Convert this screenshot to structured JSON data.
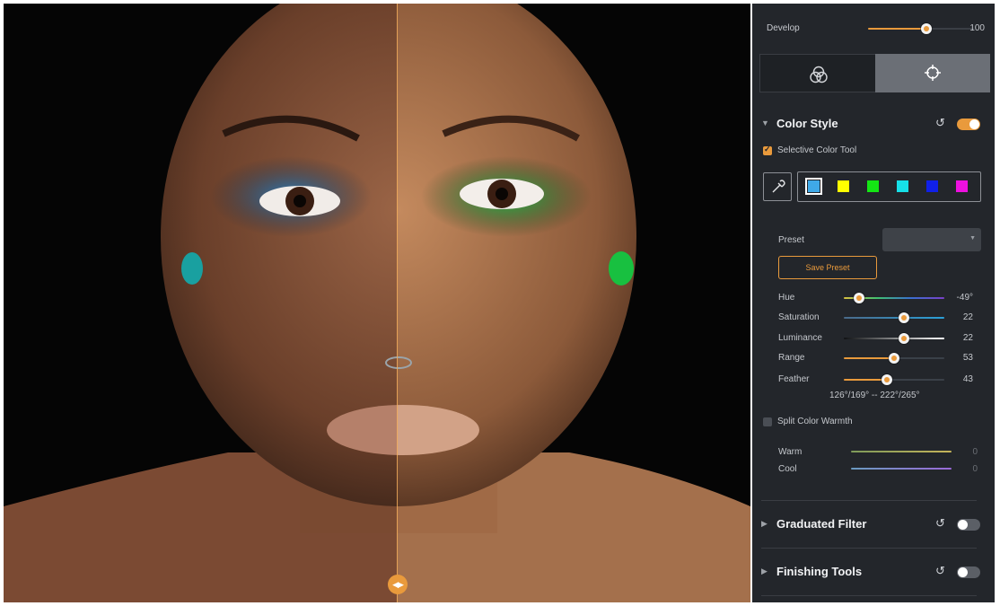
{
  "develop": {
    "label": "Develop",
    "value": "100",
    "fraction": 0.55
  },
  "mode_tabs": [
    {
      "icon": "color-circles-icon",
      "active": false
    },
    {
      "icon": "crosshair-icon",
      "active": true
    }
  ],
  "color_style": {
    "title": "Color Style",
    "enabled": true,
    "selective_color_tool": {
      "label": "Selective Color Tool",
      "checked": true
    },
    "swatches": [
      "#3fa9e8",
      "#ffff00",
      "#14e614",
      "#16e0e8",
      "#1020e8",
      "#ee10e0"
    ],
    "selected_swatch": 0,
    "preset": {
      "label": "Preset",
      "value": ""
    },
    "save_preset_label": "Save Preset",
    "sliders": [
      {
        "label": "Hue",
        "value": "-49°",
        "fraction": 0.15
      },
      {
        "label": "Saturation",
        "value": "22",
        "fraction": 0.6
      },
      {
        "label": "Luminance",
        "value": "22",
        "fraction": 0.6
      },
      {
        "label": "Range",
        "value": "53",
        "fraction": 0.5
      },
      {
        "label": "Feather",
        "value": "43",
        "fraction": 0.43
      }
    ],
    "range_readout": "126°/169° -- 222°/265°",
    "split_color_warmth": {
      "label": "Split Color Warmth",
      "checked": false
    },
    "warmth_sliders": [
      {
        "label": "Warm",
        "value": "0"
      },
      {
        "label": "Cool",
        "value": "0"
      }
    ]
  },
  "graduated_filter": {
    "title": "Graduated Filter",
    "enabled": false
  },
  "finishing_tools": {
    "title": "Finishing Tools",
    "enabled": false
  },
  "colors": {
    "panel_bg": "#23262b",
    "accent": "#e99a3c",
    "active_tab": "#6b6f76"
  }
}
